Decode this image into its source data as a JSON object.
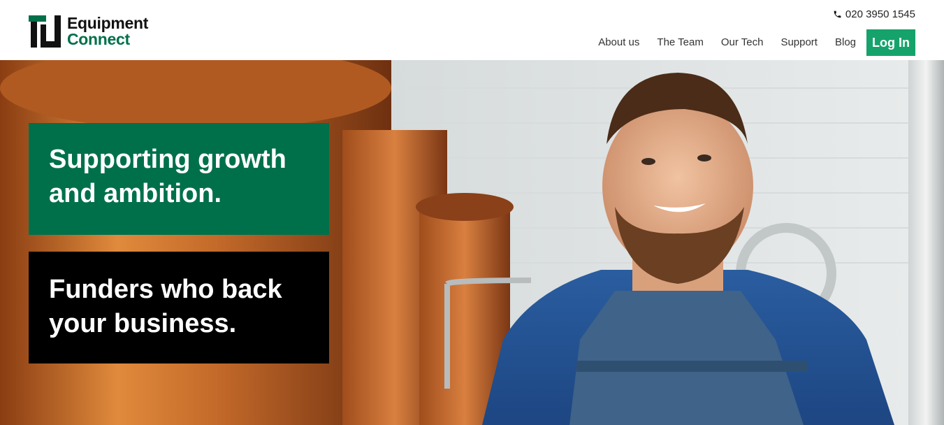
{
  "brand": {
    "line1": "Equipment",
    "line2": "Connect",
    "green": "#00704a",
    "accent": "#16a36b"
  },
  "header": {
    "phone": "020 3950 1545",
    "phone_icon": "phone-icon",
    "nav": [
      "About us",
      "The Team",
      "Our Tech",
      "Support",
      "Blog"
    ],
    "login_label": "Log In"
  },
  "hero": {
    "headline": "Supporting growth and ambition.",
    "subheadline": "Funders who back your business.",
    "image_description": "smiling-brewer-in-denim-apron"
  }
}
